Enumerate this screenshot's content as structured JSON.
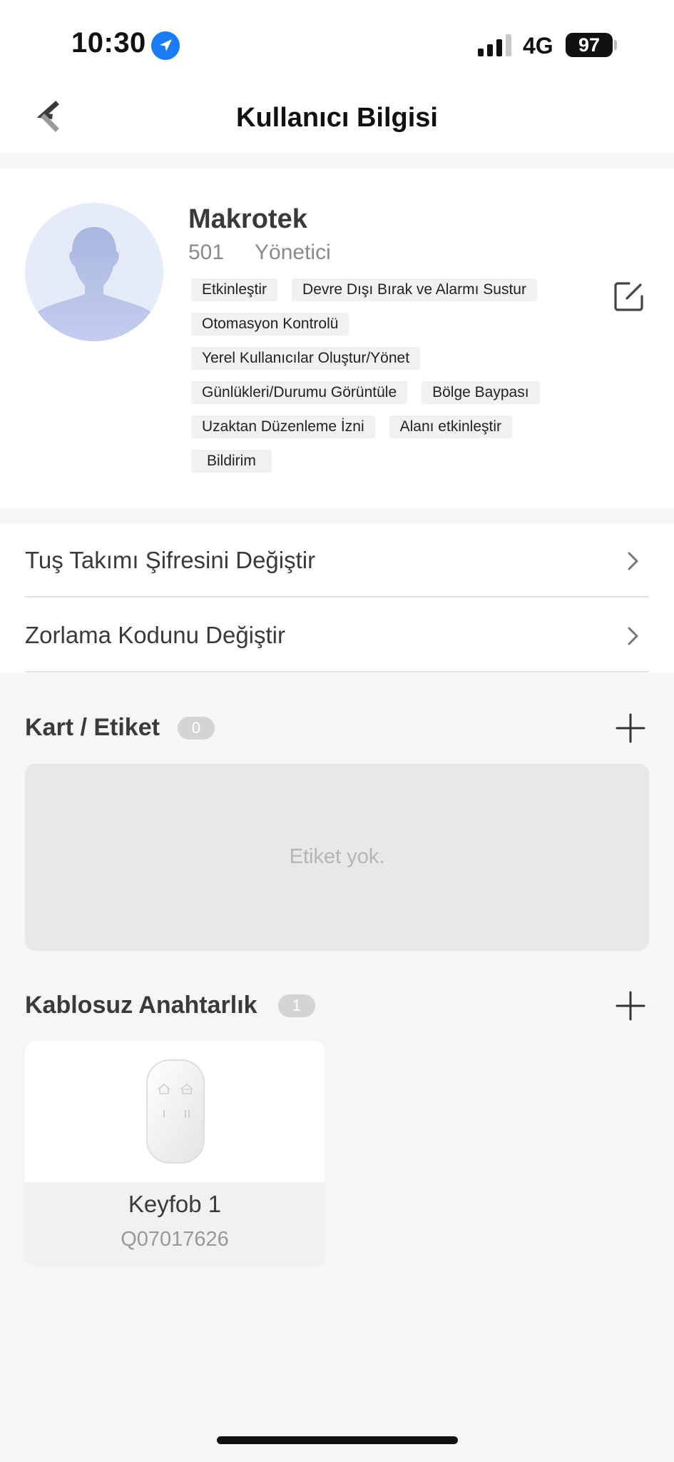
{
  "status_bar": {
    "time": "10:30",
    "network": "4G",
    "battery": "97"
  },
  "header": {
    "title": "Kullanıcı Bilgisi"
  },
  "profile": {
    "name": "Makrotek",
    "id": "501",
    "role": "Yönetici",
    "permissions": [
      "Etkinleştir",
      "Devre Dışı Bırak ve Alarmı Sustur",
      "Otomasyon Kontrolü",
      "Yerel Kullanıcılar Oluştur/Yönet",
      "Günlükleri/Durumu Görüntüle",
      "Bölge Baypası",
      "Uzaktan Düzenleme İzni",
      "Alanı etkinleştir",
      "Bildirim"
    ]
  },
  "menu": {
    "items": [
      {
        "label": "Tuş Takımı Şifresini Değiştir"
      },
      {
        "label": "Zorlama Kodunu Değiştir"
      }
    ]
  },
  "cards_section": {
    "title": "Kart / Etiket",
    "count": "0",
    "empty_text": "Etiket yok."
  },
  "keyfob_section": {
    "title": "Kablosuz Anahtarlık",
    "count": "1",
    "devices": [
      {
        "name": "Keyfob 1",
        "serial": "Q07017626"
      }
    ]
  },
  "colors": {
    "accent": "#1a7cf5",
    "background": "#f6f6f6",
    "card": "#ffffff",
    "tag_background": "#f1f1f1",
    "badge": "#d4d4d4"
  },
  "icons": [
    "location-arrow-icon",
    "signal-icon",
    "battery-icon",
    "back-chevron-icon",
    "user-silhouette-icon",
    "edit-icon",
    "chevron-right-icon",
    "plus-icon",
    "keyfob-icon"
  ]
}
